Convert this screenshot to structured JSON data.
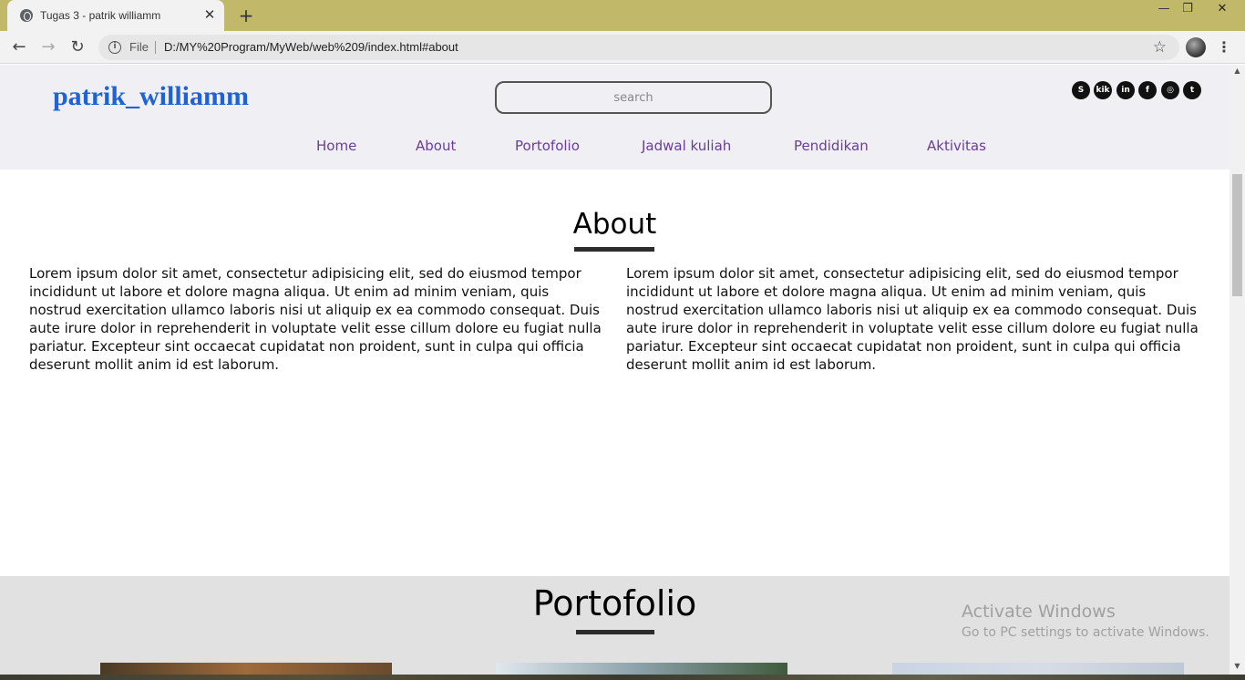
{
  "browser": {
    "tab_title": "Tugas 3 - patrik williamm",
    "tab_close": "✕",
    "new_tab": "+",
    "window_minimize": "—",
    "window_restore": "❐",
    "window_close": "✕",
    "file_label": "File",
    "url": "D:/MY%20Program/MyWeb/web%209/index.html#about",
    "star_icon": "☆",
    "menu_icon": "⋮",
    "back_icon": "←",
    "forward_icon": "→",
    "reload_icon": "↻",
    "info_icon": "i"
  },
  "header": {
    "logo": "patrik_williamm",
    "search_placeholder": "search",
    "socials": [
      {
        "name": "skype",
        "glyph": "S"
      },
      {
        "name": "kik",
        "glyph": "kik"
      },
      {
        "name": "linkedin",
        "glyph": "in"
      },
      {
        "name": "facebook",
        "glyph": "f"
      },
      {
        "name": "instagram",
        "glyph": "◎"
      },
      {
        "name": "tumblr",
        "glyph": "t"
      }
    ],
    "nav": [
      "Home",
      "About",
      "Portofolio",
      "Jadwal kuliah",
      "Pendidikan",
      "Aktivitas"
    ]
  },
  "about": {
    "title": "About",
    "left_text": "Lorem ipsum dolor sit amet, consectetur adipisicing elit, sed do eiusmod tempor incididunt ut labore et dolore magna aliqua. Ut enim ad minim veniam, quis nostrud exercitation ullamco laboris nisi ut aliquip ex ea commodo consequat. Duis aute irure dolor in reprehenderit in voluptate velit esse cillum dolore eu fugiat nulla pariatur. Excepteur sint occaecat cupidatat non proident, sunt in culpa qui officia deserunt mollit anim id est laborum.",
    "right_text": "Lorem ipsum dolor sit amet, consectetur adipisicing elit, sed do eiusmod tempor incididunt ut labore et dolore magna aliqua. Ut enim ad minim veniam, quis nostrud exercitation ullamco laboris nisi ut aliquip ex ea commodo consequat. Duis aute irure dolor in reprehenderit in voluptate velit esse cillum dolore eu fugiat nulla pariatur. Excepteur sint occaecat cupidatat non proident, sunt in culpa qui officia deserunt mollit anim id est laborum."
  },
  "portfolio": {
    "title": "Portofolio"
  },
  "watermark": {
    "title": "Activate Windows",
    "subtitle": "Go to PC settings to activate Windows."
  },
  "colors": {
    "tabbar": "#c2b869",
    "logo": "#1e63d6",
    "nav_link": "#6a3d9a",
    "header_bg": "#efeff4",
    "portfolio_bg": "#e1e1e1"
  }
}
